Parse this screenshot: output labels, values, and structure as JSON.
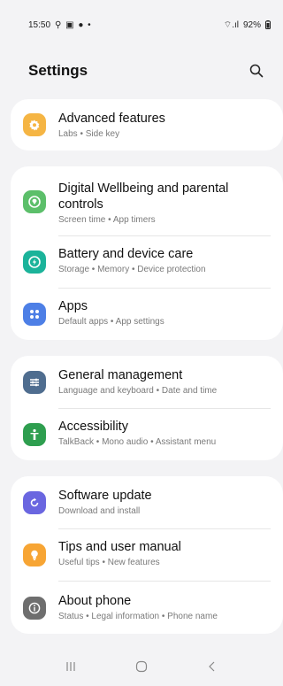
{
  "status": {
    "time": "15:50",
    "icons_left": "⚲ ▣ ● •",
    "signal": "⌔.ıl",
    "battery": "92%"
  },
  "header": {
    "title": "Settings"
  },
  "items": [
    {
      "title": "Advanced features",
      "subtitle": "Labs • Side key",
      "color": "#f5b544"
    },
    {
      "title": "Digital Wellbeing and parental controls",
      "subtitle": "Screen time • App timers",
      "color": "#5cbf6a"
    },
    {
      "title": "Battery and device care",
      "subtitle": "Storage • Memory • Device protection",
      "color": "#1bb39a"
    },
    {
      "title": "Apps",
      "subtitle": "Default apps • App settings",
      "color": "#4d7fe6"
    },
    {
      "title": "General management",
      "subtitle": "Language and keyboard • Date and time",
      "color": "#4f6d8f"
    },
    {
      "title": "Accessibility",
      "subtitle": "TalkBack • Mono audio • Assistant menu",
      "color": "#2e9e4f"
    },
    {
      "title": "Software update",
      "subtitle": "Download and install",
      "color": "#6a66e0"
    },
    {
      "title": "Tips and user manual",
      "subtitle": "Useful tips • New features",
      "color": "#f7a534"
    },
    {
      "title": "About phone",
      "subtitle": "Status • Legal information • Phone name",
      "color": "#6e6e6e"
    }
  ]
}
